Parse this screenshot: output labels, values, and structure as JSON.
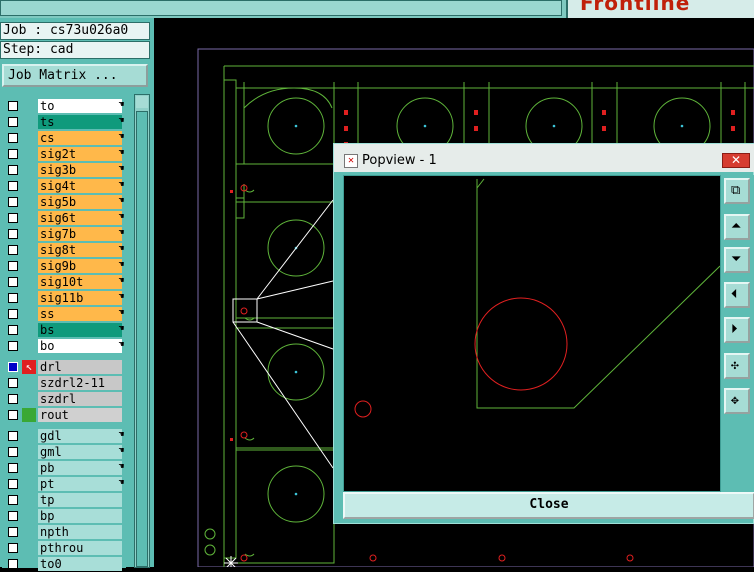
{
  "topbar": {
    "logo": "Frontline"
  },
  "job": {
    "job_label": "Job : cs73u026a0",
    "step_label": "Step: cad",
    "matrix_button": "Job Matrix ..."
  },
  "layers": [
    {
      "name": "to",
      "color": "#ffffff",
      "hand": true
    },
    {
      "name": "ts",
      "color": "#0f9a7c",
      "hand": true
    },
    {
      "name": "cs",
      "color": "#ffb84a",
      "hand": true
    },
    {
      "name": "sig2t",
      "color": "#ffb84a",
      "hand": true
    },
    {
      "name": "sig3b",
      "color": "#ffb84a",
      "hand": true
    },
    {
      "name": "sig4t",
      "color": "#ffb84a",
      "hand": true
    },
    {
      "name": "sig5b",
      "color": "#ffb84a",
      "hand": true
    },
    {
      "name": "sig6t",
      "color": "#ffb84a",
      "hand": true
    },
    {
      "name": "sig7b",
      "color": "#ffb84a",
      "hand": true
    },
    {
      "name": "sig8t",
      "color": "#ffb84a",
      "hand": true
    },
    {
      "name": "sig9b",
      "color": "#ffb84a",
      "hand": true
    },
    {
      "name": "sig10t",
      "color": "#ffb84a",
      "hand": true
    },
    {
      "name": "sig11b",
      "color": "#ffb84a",
      "hand": true
    },
    {
      "name": "ss",
      "color": "#ffb84a",
      "hand": true
    },
    {
      "name": "bs",
      "color": "#0f9a7c",
      "hand": true
    },
    {
      "name": "bo",
      "color": "#ffffff",
      "hand": true
    }
  ],
  "drill_layers": [
    {
      "name": "drl",
      "color": "#c8c8c8",
      "active": true
    },
    {
      "name": "szdrl2-11",
      "color": "#c8c8c8"
    },
    {
      "name": "szdrl",
      "color": "#c8c8c8"
    },
    {
      "name": "rout",
      "color": "#d0d0d0",
      "green": true
    }
  ],
  "misc_layers": [
    {
      "name": "gdl",
      "color": "#a8ded8",
      "hand": true
    },
    {
      "name": "gml",
      "color": "#a8ded8",
      "hand": true
    },
    {
      "name": "pb",
      "color": "#a8ded8",
      "hand": true
    },
    {
      "name": "pt",
      "color": "#a8ded8",
      "hand": true
    },
    {
      "name": "tp",
      "color": "#a8ded8",
      "hand": false
    },
    {
      "name": "bp",
      "color": "#a8ded8",
      "hand": false
    },
    {
      "name": "npth",
      "color": "#a8ded8",
      "hand": false
    },
    {
      "name": "pthrou",
      "color": "#a8ded8",
      "hand": false
    },
    {
      "name": "to0",
      "color": "#a8ded8",
      "hand": false
    }
  ],
  "popview": {
    "title": "Popview - 1",
    "close_label": "Close",
    "close_x": "✕"
  },
  "colors": {
    "outline": "#5fb43a",
    "pad": "#e02020",
    "panel": "#5dbdb3"
  }
}
